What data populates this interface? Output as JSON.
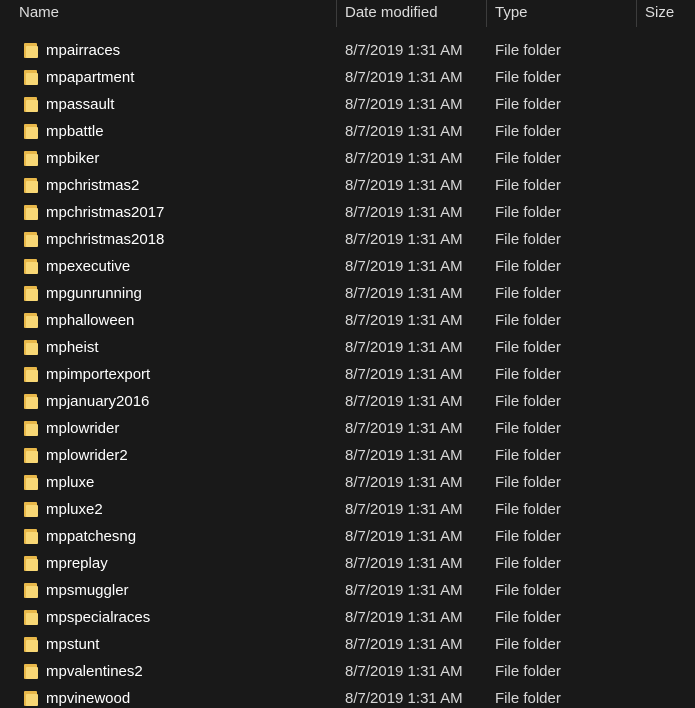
{
  "columns": {
    "name": "Name",
    "date_modified": "Date modified",
    "type": "Type",
    "size": "Size"
  },
  "sort_indicator": "^",
  "colors": {
    "background": "#191919",
    "folder_back": "#e8b84a",
    "folder_front": "#f8d775",
    "text": "#ffffff",
    "subtext": "#d6d6d6"
  },
  "rows": [
    {
      "icon": "folder-icon",
      "name": "mpairraces",
      "date": "8/7/2019 1:31 AM",
      "type": "File folder",
      "size": ""
    },
    {
      "icon": "folder-icon",
      "name": "mpapartment",
      "date": "8/7/2019 1:31 AM",
      "type": "File folder",
      "size": ""
    },
    {
      "icon": "folder-icon",
      "name": "mpassault",
      "date": "8/7/2019 1:31 AM",
      "type": "File folder",
      "size": ""
    },
    {
      "icon": "folder-icon",
      "name": "mpbattle",
      "date": "8/7/2019 1:31 AM",
      "type": "File folder",
      "size": ""
    },
    {
      "icon": "folder-icon",
      "name": "mpbiker",
      "date": "8/7/2019 1:31 AM",
      "type": "File folder",
      "size": ""
    },
    {
      "icon": "folder-icon",
      "name": "mpchristmas2",
      "date": "8/7/2019 1:31 AM",
      "type": "File folder",
      "size": ""
    },
    {
      "icon": "folder-icon",
      "name": "mpchristmas2017",
      "date": "8/7/2019 1:31 AM",
      "type": "File folder",
      "size": ""
    },
    {
      "icon": "folder-icon",
      "name": "mpchristmas2018",
      "date": "8/7/2019 1:31 AM",
      "type": "File folder",
      "size": ""
    },
    {
      "icon": "folder-icon",
      "name": "mpexecutive",
      "date": "8/7/2019 1:31 AM",
      "type": "File folder",
      "size": ""
    },
    {
      "icon": "folder-icon",
      "name": "mpgunrunning",
      "date": "8/7/2019 1:31 AM",
      "type": "File folder",
      "size": ""
    },
    {
      "icon": "folder-icon",
      "name": "mphalloween",
      "date": "8/7/2019 1:31 AM",
      "type": "File folder",
      "size": ""
    },
    {
      "icon": "folder-icon",
      "name": "mpheist",
      "date": "8/7/2019 1:31 AM",
      "type": "File folder",
      "size": ""
    },
    {
      "icon": "folder-icon",
      "name": "mpimportexport",
      "date": "8/7/2019 1:31 AM",
      "type": "File folder",
      "size": ""
    },
    {
      "icon": "folder-icon",
      "name": "mpjanuary2016",
      "date": "8/7/2019 1:31 AM",
      "type": "File folder",
      "size": ""
    },
    {
      "icon": "folder-icon",
      "name": "mplowrider",
      "date": "8/7/2019 1:31 AM",
      "type": "File folder",
      "size": ""
    },
    {
      "icon": "folder-icon",
      "name": "mplowrider2",
      "date": "8/7/2019 1:31 AM",
      "type": "File folder",
      "size": ""
    },
    {
      "icon": "folder-icon",
      "name": "mpluxe",
      "date": "8/7/2019 1:31 AM",
      "type": "File folder",
      "size": ""
    },
    {
      "icon": "folder-icon",
      "name": "mpluxe2",
      "date": "8/7/2019 1:31 AM",
      "type": "File folder",
      "size": ""
    },
    {
      "icon": "folder-icon",
      "name": "mppatchesng",
      "date": "8/7/2019 1:31 AM",
      "type": "File folder",
      "size": ""
    },
    {
      "icon": "folder-icon",
      "name": "mpreplay",
      "date": "8/7/2019 1:31 AM",
      "type": "File folder",
      "size": ""
    },
    {
      "icon": "folder-icon",
      "name": "mpsmuggler",
      "date": "8/7/2019 1:31 AM",
      "type": "File folder",
      "size": ""
    },
    {
      "icon": "folder-icon",
      "name": "mpspecialraces",
      "date": "8/7/2019 1:31 AM",
      "type": "File folder",
      "size": ""
    },
    {
      "icon": "folder-icon",
      "name": "mpstunt",
      "date": "8/7/2019 1:31 AM",
      "type": "File folder",
      "size": ""
    },
    {
      "icon": "folder-icon",
      "name": "mpvalentines2",
      "date": "8/7/2019 1:31 AM",
      "type": "File folder",
      "size": ""
    },
    {
      "icon": "folder-icon",
      "name": "mpvinewood",
      "date": "8/7/2019 1:31 AM",
      "type": "File folder",
      "size": ""
    }
  ]
}
